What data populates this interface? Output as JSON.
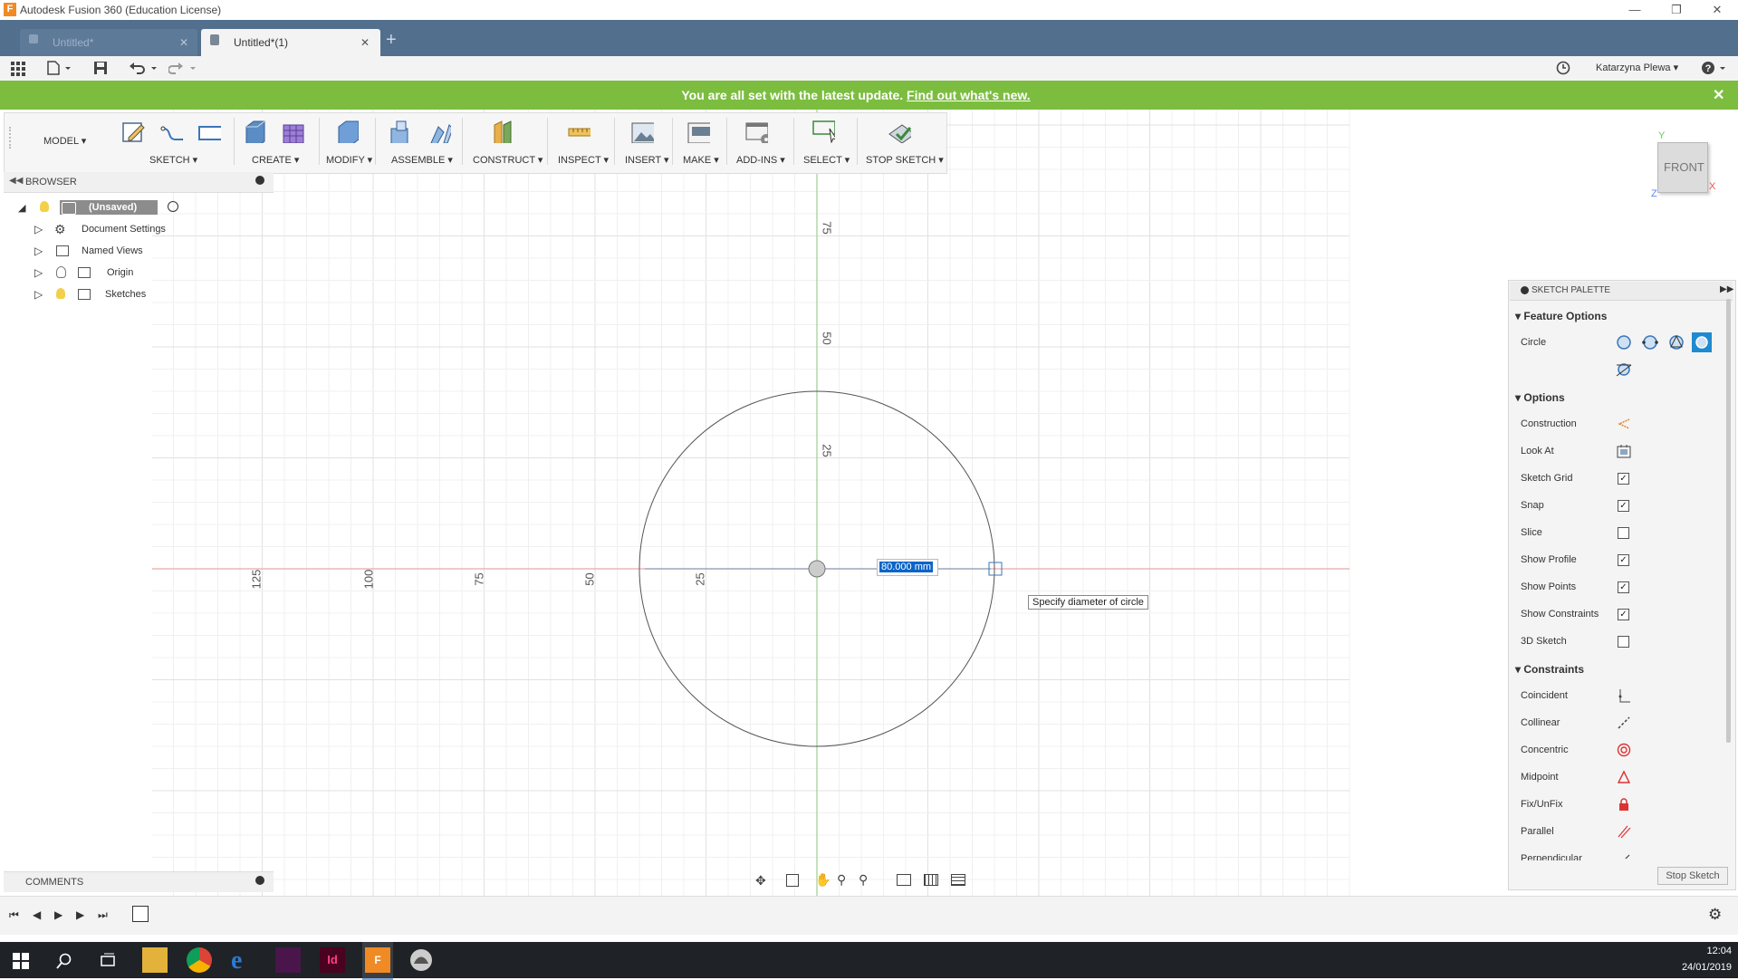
{
  "window": {
    "title": "Autodesk Fusion 360 (Education License)",
    "logo_letter": "F"
  },
  "tabs": [
    {
      "label": "Untitled*"
    },
    {
      "label": "Untitled*(1)"
    }
  ],
  "user": {
    "name": "Katarzyna Plewa"
  },
  "notification": {
    "message": "You are all set with the latest update.",
    "link": "Find out what's new."
  },
  "ribbon": {
    "workspace": "MODEL",
    "groups": [
      "SKETCH",
      "CREATE",
      "MODIFY",
      "ASSEMBLE",
      "CONSTRUCT",
      "INSPECT",
      "INSERT",
      "MAKE",
      "ADD-INS",
      "SELECT",
      "STOP SKETCH"
    ]
  },
  "browser": {
    "title": "BROWSER",
    "root": "(Unsaved)",
    "items": [
      "Document Settings",
      "Named Views",
      "Origin",
      "Sketches"
    ]
  },
  "comments": {
    "title": "COMMENTS"
  },
  "viewcube": {
    "face": "FRONT",
    "axes": [
      "Y",
      "X",
      "Z"
    ]
  },
  "canvas": {
    "x_ticks": [
      "125",
      "100",
      "75",
      "50",
      "25"
    ],
    "y_ticks": [
      "75",
      "50",
      "25"
    ],
    "dimension_value": "80.000 mm",
    "tooltip": "Specify diameter of circle"
  },
  "palette": {
    "title": "SKETCH PALETTE",
    "feature_options_title": "Feature Options",
    "feature_label": "Circle",
    "options_title": "Options",
    "options": [
      {
        "label": "Construction",
        "kind": "icon",
        "icon": "construction-icon"
      },
      {
        "label": "Look At",
        "kind": "icon",
        "icon": "look-at-icon"
      },
      {
        "label": "Sketch Grid",
        "kind": "check",
        "checked": true
      },
      {
        "label": "Snap",
        "kind": "check",
        "checked": true
      },
      {
        "label": "Slice",
        "kind": "check",
        "checked": false
      },
      {
        "label": "Show Profile",
        "kind": "check",
        "checked": true
      },
      {
        "label": "Show Points",
        "kind": "check",
        "checked": true
      },
      {
        "label": "Show Constraints",
        "kind": "check",
        "checked": true
      },
      {
        "label": "3D Sketch",
        "kind": "check",
        "checked": false
      }
    ],
    "constraints_title": "Constraints",
    "constraints": [
      "Coincident",
      "Collinear",
      "Concentric",
      "Midpoint",
      "Fix/UnFix",
      "Parallel",
      "Perpendicular"
    ],
    "stop_button": "Stop Sketch"
  },
  "taskbar": {
    "time": "12:04",
    "date": "24/01/2019"
  }
}
